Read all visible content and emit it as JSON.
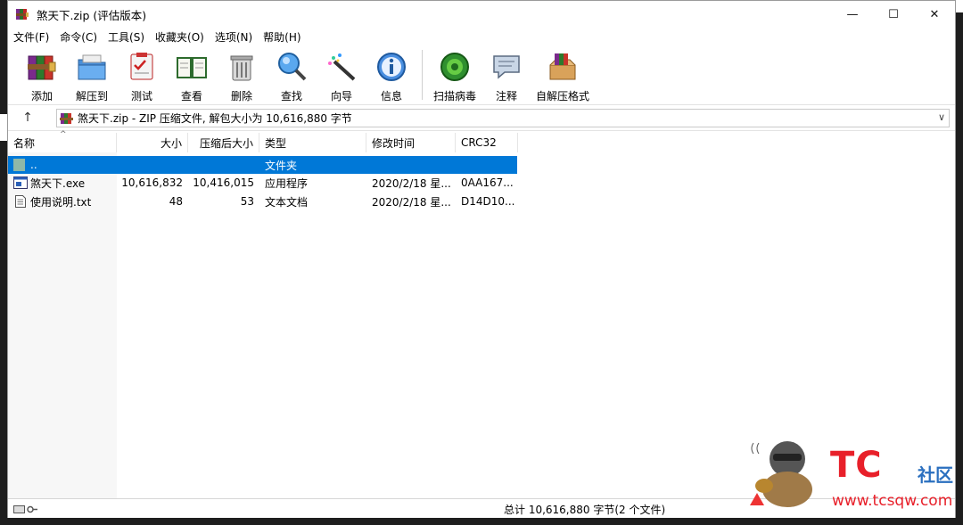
{
  "window": {
    "title": "煞天下.zip (评估版本)",
    "controls": [
      "—",
      "☐",
      "✕"
    ]
  },
  "menu": [
    "文件(F)",
    "命令(C)",
    "工具(S)",
    "收藏夹(O)",
    "选项(N)",
    "帮助(H)"
  ],
  "toolbar": {
    "group1": [
      {
        "label": "添加",
        "icon": "add-books-icon"
      },
      {
        "label": "解压到",
        "icon": "extract-folder-icon"
      },
      {
        "label": "测试",
        "icon": "test-clipboard-icon"
      },
      {
        "label": "查看",
        "icon": "view-book-icon"
      },
      {
        "label": "删除",
        "icon": "trash-bin-icon"
      },
      {
        "label": "查找",
        "icon": "magnifier-icon"
      },
      {
        "label": "向导",
        "icon": "wizard-wand-icon"
      },
      {
        "label": "信息",
        "icon": "info-icon"
      }
    ],
    "group2": [
      {
        "label": "扫描病毒",
        "icon": "virus-scan-icon"
      },
      {
        "label": "注释",
        "icon": "comment-icon"
      },
      {
        "label": "自解压格式",
        "icon": "sfx-box-icon"
      }
    ]
  },
  "address": {
    "text": "煞天下.zip - ZIP 压缩文件, 解包大小为 10,616,880 字节"
  },
  "columns": {
    "name": "名称",
    "size": "大小",
    "packed": "压缩后大小",
    "type": "类型",
    "modified": "修改时间",
    "crc": "CRC32"
  },
  "rows": [
    {
      "name": "..",
      "size": "",
      "packed": "",
      "type": "文件夹",
      "modified": "",
      "crc": "",
      "icon": "folder-up-icon",
      "selected": true
    },
    {
      "name": "煞天下.exe",
      "size": "10,616,832",
      "packed": "10,416,015",
      "type": "应用程序",
      "modified": "2020/2/18 星...",
      "crc": "0AA167...",
      "icon": "exe-file-icon",
      "selected": false
    },
    {
      "name": "使用说明.txt",
      "size": "48",
      "packed": "53",
      "type": "文本文档",
      "modified": "2020/2/18 星...",
      "crc": "D14D10...",
      "icon": "txt-file-icon",
      "selected": false
    }
  ],
  "status": {
    "text": "总计 10,616,880 字节(2 个文件)"
  },
  "watermark": {
    "name": "TC",
    "sub": "社区",
    "url": "www.tcsqw.com"
  },
  "colors": {
    "selection": "#0078d7",
    "watermark_red": "#e8202a",
    "watermark_blue": "#2a6fbf"
  }
}
